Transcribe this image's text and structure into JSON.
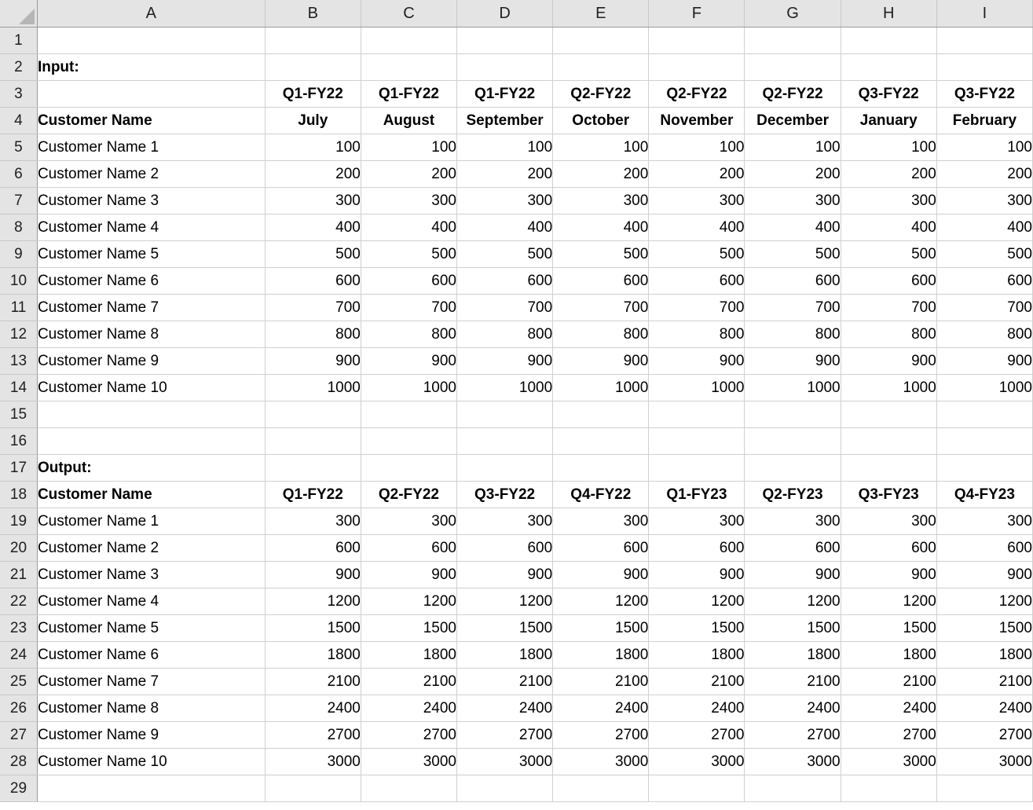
{
  "app": {
    "type": "spreadsheet",
    "select_all_icon": "select-all-triangle-icon"
  },
  "columns": [
    "A",
    "B",
    "C",
    "D",
    "E",
    "F",
    "G",
    "H",
    "I"
  ],
  "row_numbers": [
    1,
    2,
    3,
    4,
    5,
    6,
    7,
    8,
    9,
    10,
    11,
    12,
    13,
    14,
    15,
    16,
    17,
    18,
    19,
    20,
    21,
    22,
    23,
    24,
    25,
    26,
    27,
    28,
    29
  ],
  "labels": {
    "input": "Input:",
    "output": "Output:",
    "customer_name": "Customer Name"
  },
  "input_table": {
    "quarter_row": [
      "Q1-FY22",
      "Q1-FY22",
      "Q1-FY22",
      "Q2-FY22",
      "Q2-FY22",
      "Q2-FY22",
      "Q3-FY22",
      "Q3-FY22"
    ],
    "month_row": [
      "July",
      "August",
      "September",
      "October",
      "November",
      "December",
      "January",
      "February"
    ],
    "row_label_header": "Customer Name",
    "rows": [
      {
        "name": "Customer Name 1",
        "values": [
          "100",
          "100",
          "100",
          "100",
          "100",
          "100",
          "100",
          "100"
        ]
      },
      {
        "name": "Customer Name 2",
        "values": [
          "200",
          "200",
          "200",
          "200",
          "200",
          "200",
          "200",
          "200"
        ]
      },
      {
        "name": "Customer Name 3",
        "values": [
          "300",
          "300",
          "300",
          "300",
          "300",
          "300",
          "300",
          "300"
        ]
      },
      {
        "name": "Customer Name 4",
        "values": [
          "400",
          "400",
          "400",
          "400",
          "400",
          "400",
          "400",
          "400"
        ]
      },
      {
        "name": "Customer Name 5",
        "values": [
          "500",
          "500",
          "500",
          "500",
          "500",
          "500",
          "500",
          "500"
        ]
      },
      {
        "name": "Customer Name 6",
        "values": [
          "600",
          "600",
          "600",
          "600",
          "600",
          "600",
          "600",
          "600"
        ]
      },
      {
        "name": "Customer Name 7",
        "values": [
          "700",
          "700",
          "700",
          "700",
          "700",
          "700",
          "700",
          "700"
        ]
      },
      {
        "name": "Customer Name 8",
        "values": [
          "800",
          "800",
          "800",
          "800",
          "800",
          "800",
          "800",
          "800"
        ]
      },
      {
        "name": "Customer Name 9",
        "values": [
          "900",
          "900",
          "900",
          "900",
          "900",
          "900",
          "900",
          "900"
        ]
      },
      {
        "name": "Customer Name 10",
        "values": [
          "1000",
          "1000",
          "1000",
          "1000",
          "1000",
          "1000",
          "1000",
          "1000"
        ]
      }
    ]
  },
  "output_table": {
    "header_row": [
      "Q1-FY22",
      "Q2-FY22",
      "Q3-FY22",
      "Q4-FY22",
      "Q1-FY23",
      "Q2-FY23",
      "Q3-FY23",
      "Q4-FY23"
    ],
    "row_label_header": "Customer Name",
    "rows": [
      {
        "name": "Customer Name 1",
        "values": [
          "300",
          "300",
          "300",
          "300",
          "300",
          "300",
          "300",
          "300"
        ]
      },
      {
        "name": "Customer Name 2",
        "values": [
          "600",
          "600",
          "600",
          "600",
          "600",
          "600",
          "600",
          "600"
        ]
      },
      {
        "name": "Customer Name 3",
        "values": [
          "900",
          "900",
          "900",
          "900",
          "900",
          "900",
          "900",
          "900"
        ]
      },
      {
        "name": "Customer Name 4",
        "values": [
          "1200",
          "1200",
          "1200",
          "1200",
          "1200",
          "1200",
          "1200",
          "1200"
        ]
      },
      {
        "name": "Customer Name 5",
        "values": [
          "1500",
          "1500",
          "1500",
          "1500",
          "1500",
          "1500",
          "1500",
          "1500"
        ]
      },
      {
        "name": "Customer Name 6",
        "values": [
          "1800",
          "1800",
          "1800",
          "1800",
          "1800",
          "1800",
          "1800",
          "1800"
        ]
      },
      {
        "name": "Customer Name 7",
        "values": [
          "2100",
          "2100",
          "2100",
          "2100",
          "2100",
          "2100",
          "2100",
          "2100"
        ]
      },
      {
        "name": "Customer Name 8",
        "values": [
          "2400",
          "2400",
          "2400",
          "2400",
          "2400",
          "2400",
          "2400",
          "2400"
        ]
      },
      {
        "name": "Customer Name 9",
        "values": [
          "2700",
          "2700",
          "2700",
          "2700",
          "2700",
          "2700",
          "2700",
          "2700"
        ]
      },
      {
        "name": "Customer Name 10",
        "values": [
          "3000",
          "3000",
          "3000",
          "3000",
          "3000",
          "3000",
          "3000",
          "3000"
        ]
      }
    ]
  },
  "grid_rows": [
    {
      "n": 1,
      "a": "",
      "bold_a": false,
      "cells": [
        "",
        "",
        "",
        "",
        "",
        "",
        "",
        ""
      ],
      "align": "num",
      "bold_cells": false
    },
    {
      "n": 2,
      "a": "Input:",
      "bold_a": true,
      "cells": [
        "",
        "",
        "",
        "",
        "",
        "",
        "",
        ""
      ],
      "align": "num",
      "bold_cells": false
    },
    {
      "n": 3,
      "a": "",
      "bold_a": false,
      "cells": [
        "Q1-FY22",
        "Q1-FY22",
        "Q1-FY22",
        "Q2-FY22",
        "Q2-FY22",
        "Q2-FY22",
        "Q3-FY22",
        "Q3-FY22"
      ],
      "align": "ctr",
      "bold_cells": true
    },
    {
      "n": 4,
      "a": "Customer Name",
      "bold_a": true,
      "cells": [
        "July",
        "August",
        "September",
        "October",
        "November",
        "December",
        "January",
        "February"
      ],
      "align": "ctr",
      "bold_cells": true
    },
    {
      "n": 5,
      "a": "Customer Name 1",
      "bold_a": false,
      "cells": [
        "100",
        "100",
        "100",
        "100",
        "100",
        "100",
        "100",
        "100"
      ],
      "align": "num",
      "bold_cells": false
    },
    {
      "n": 6,
      "a": "Customer Name 2",
      "bold_a": false,
      "cells": [
        "200",
        "200",
        "200",
        "200",
        "200",
        "200",
        "200",
        "200"
      ],
      "align": "num",
      "bold_cells": false
    },
    {
      "n": 7,
      "a": "Customer Name 3",
      "bold_a": false,
      "cells": [
        "300",
        "300",
        "300",
        "300",
        "300",
        "300",
        "300",
        "300"
      ],
      "align": "num",
      "bold_cells": false
    },
    {
      "n": 8,
      "a": "Customer Name 4",
      "bold_a": false,
      "cells": [
        "400",
        "400",
        "400",
        "400",
        "400",
        "400",
        "400",
        "400"
      ],
      "align": "num",
      "bold_cells": false
    },
    {
      "n": 9,
      "a": "Customer Name 5",
      "bold_a": false,
      "cells": [
        "500",
        "500",
        "500",
        "500",
        "500",
        "500",
        "500",
        "500"
      ],
      "align": "num",
      "bold_cells": false
    },
    {
      "n": 10,
      "a": "Customer Name 6",
      "bold_a": false,
      "cells": [
        "600",
        "600",
        "600",
        "600",
        "600",
        "600",
        "600",
        "600"
      ],
      "align": "num",
      "bold_cells": false
    },
    {
      "n": 11,
      "a": "Customer Name 7",
      "bold_a": false,
      "cells": [
        "700",
        "700",
        "700",
        "700",
        "700",
        "700",
        "700",
        "700"
      ],
      "align": "num",
      "bold_cells": false
    },
    {
      "n": 12,
      "a": "Customer Name 8",
      "bold_a": false,
      "cells": [
        "800",
        "800",
        "800",
        "800",
        "800",
        "800",
        "800",
        "800"
      ],
      "align": "num",
      "bold_cells": false
    },
    {
      "n": 13,
      "a": "Customer Name 9",
      "bold_a": false,
      "cells": [
        "900",
        "900",
        "900",
        "900",
        "900",
        "900",
        "900",
        "900"
      ],
      "align": "num",
      "bold_cells": false
    },
    {
      "n": 14,
      "a": "Customer Name 10",
      "bold_a": false,
      "cells": [
        "1000",
        "1000",
        "1000",
        "1000",
        "1000",
        "1000",
        "1000",
        "1000"
      ],
      "align": "num",
      "bold_cells": false
    },
    {
      "n": 15,
      "a": "",
      "bold_a": false,
      "cells": [
        "",
        "",
        "",
        "",
        "",
        "",
        "",
        ""
      ],
      "align": "num",
      "bold_cells": false
    },
    {
      "n": 16,
      "a": "",
      "bold_a": false,
      "cells": [
        "",
        "",
        "",
        "",
        "",
        "",
        "",
        ""
      ],
      "align": "num",
      "bold_cells": false
    },
    {
      "n": 17,
      "a": "Output:",
      "bold_a": true,
      "cells": [
        "",
        "",
        "",
        "",
        "",
        "",
        "",
        ""
      ],
      "align": "num",
      "bold_cells": false
    },
    {
      "n": 18,
      "a": "Customer Name",
      "bold_a": true,
      "cells": [
        "Q1-FY22",
        "Q2-FY22",
        "Q3-FY22",
        "Q4-FY22",
        "Q1-FY23",
        "Q2-FY23",
        "Q3-FY23",
        "Q4-FY23"
      ],
      "align": "ctr",
      "bold_cells": true
    },
    {
      "n": 19,
      "a": "Customer Name 1",
      "bold_a": false,
      "cells": [
        "300",
        "300",
        "300",
        "300",
        "300",
        "300",
        "300",
        "300"
      ],
      "align": "num",
      "bold_cells": false
    },
    {
      "n": 20,
      "a": "Customer Name 2",
      "bold_a": false,
      "cells": [
        "600",
        "600",
        "600",
        "600",
        "600",
        "600",
        "600",
        "600"
      ],
      "align": "num",
      "bold_cells": false
    },
    {
      "n": 21,
      "a": "Customer Name 3",
      "bold_a": false,
      "cells": [
        "900",
        "900",
        "900",
        "900",
        "900",
        "900",
        "900",
        "900"
      ],
      "align": "num",
      "bold_cells": false
    },
    {
      "n": 22,
      "a": "Customer Name 4",
      "bold_a": false,
      "cells": [
        "1200",
        "1200",
        "1200",
        "1200",
        "1200",
        "1200",
        "1200",
        "1200"
      ],
      "align": "num",
      "bold_cells": false
    },
    {
      "n": 23,
      "a": "Customer Name 5",
      "bold_a": false,
      "cells": [
        "1500",
        "1500",
        "1500",
        "1500",
        "1500",
        "1500",
        "1500",
        "1500"
      ],
      "align": "num",
      "bold_cells": false
    },
    {
      "n": 24,
      "a": "Customer Name 6",
      "bold_a": false,
      "cells": [
        "1800",
        "1800",
        "1800",
        "1800",
        "1800",
        "1800",
        "1800",
        "1800"
      ],
      "align": "num",
      "bold_cells": false
    },
    {
      "n": 25,
      "a": "Customer Name 7",
      "bold_a": false,
      "cells": [
        "2100",
        "2100",
        "2100",
        "2100",
        "2100",
        "2100",
        "2100",
        "2100"
      ],
      "align": "num",
      "bold_cells": false
    },
    {
      "n": 26,
      "a": "Customer Name 8",
      "bold_a": false,
      "cells": [
        "2400",
        "2400",
        "2400",
        "2400",
        "2400",
        "2400",
        "2400",
        "2400"
      ],
      "align": "num",
      "bold_cells": false
    },
    {
      "n": 27,
      "a": "Customer Name 9",
      "bold_a": false,
      "cells": [
        "2700",
        "2700",
        "2700",
        "2700",
        "2700",
        "2700",
        "2700",
        "2700"
      ],
      "align": "num",
      "bold_cells": false
    },
    {
      "n": 28,
      "a": "Customer Name 10",
      "bold_a": false,
      "cells": [
        "3000",
        "3000",
        "3000",
        "3000",
        "3000",
        "3000",
        "3000",
        "3000"
      ],
      "align": "num",
      "bold_cells": false
    },
    {
      "n": 29,
      "a": "",
      "bold_a": false,
      "cells": [
        "",
        "",
        "",
        "",
        "",
        "",
        "",
        ""
      ],
      "align": "num",
      "bold_cells": false
    }
  ],
  "colors": {
    "header_bg": "#e4e4e4",
    "header_border": "#9a9a9a",
    "gridline": "#d0d0d0",
    "cell_bg": "#ffffff",
    "text": "#000000",
    "corner_triangle": "#b6b6b6"
  }
}
